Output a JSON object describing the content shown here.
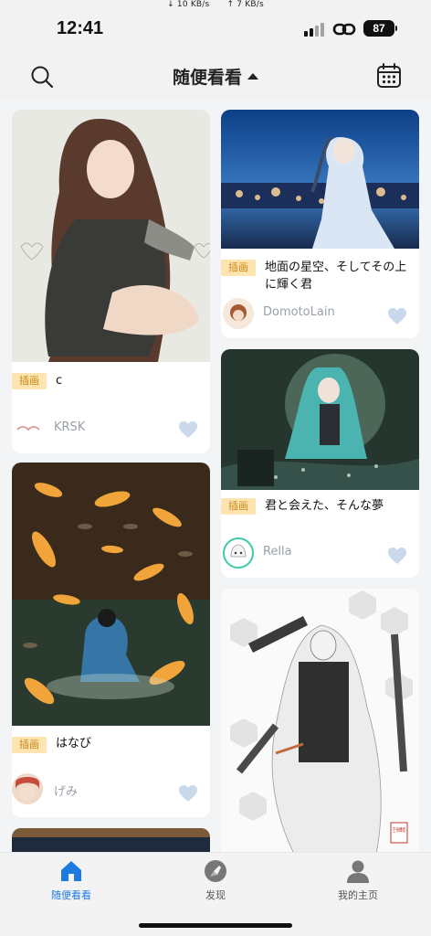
{
  "status": {
    "time": "12:41",
    "down_speed": "↓ 10 KB/s",
    "up_speed": "↑ 7 KB/s",
    "battery": "87"
  },
  "header": {
    "title": "随便看看",
    "search_icon": "search-icon",
    "calendar_icon": "calendar-icon"
  },
  "cards": [
    {
      "tag": "插画",
      "title": "c",
      "author": "KRSK"
    },
    {
      "tag": "插画",
      "title": "地面の星空、そしてその上に輝く君",
      "author": "DomotoLain"
    },
    {
      "tag": "插画",
      "title": "君と会えた、そんな夢",
      "author": "Rella"
    },
    {
      "tag": "插画",
      "title": "はなび",
      "author": "げみ"
    },
    {
      "stamp": "空母棲姫"
    }
  ],
  "nav": {
    "items": [
      {
        "label": "随便看看",
        "icon": "home-icon",
        "active": true
      },
      {
        "label": "发现",
        "icon": "compass-icon",
        "active": false
      },
      {
        "label": "我的主页",
        "icon": "user-icon",
        "active": false
      }
    ]
  },
  "colors": {
    "accent": "#1f7ae0",
    "tag_bg": "#fde4b0",
    "tag_text": "#c98a1a",
    "heart": "#c9d8ea"
  }
}
